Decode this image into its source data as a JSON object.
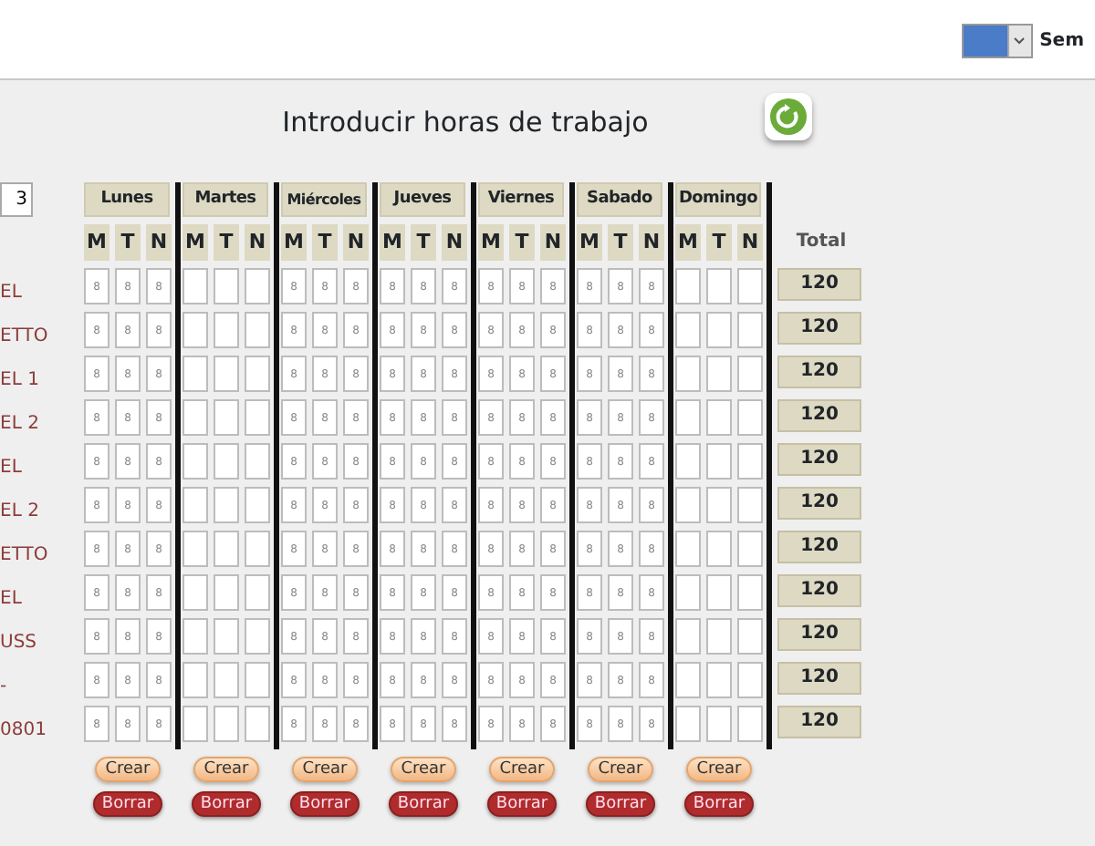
{
  "topbar": {
    "label": "Sem"
  },
  "title": "Introducir horas de trabajo",
  "week_field": {
    "value": "3"
  },
  "days": [
    {
      "label": "Lunes",
      "shifts": [
        "M",
        "T",
        "N"
      ],
      "create": "Crear",
      "delete": "Borrar"
    },
    {
      "label": "Martes",
      "shifts": [
        "M",
        "T",
        "N"
      ],
      "create": "Crear",
      "delete": "Borrar"
    },
    {
      "label": "Miércoles",
      "shifts": [
        "M",
        "T",
        "N"
      ],
      "create": "Crear",
      "delete": "Borrar"
    },
    {
      "label": "Jueves",
      "shifts": [
        "M",
        "T",
        "N"
      ],
      "create": "Crear",
      "delete": "Borrar"
    },
    {
      "label": "Viernes",
      "shifts": [
        "M",
        "T",
        "N"
      ],
      "create": "Crear",
      "delete": "Borrar"
    },
    {
      "label": "Sabado",
      "shifts": [
        "M",
        "T",
        "N"
      ],
      "create": "Crear",
      "delete": "Borrar"
    },
    {
      "label": "Domingo",
      "shifts": [
        "M",
        "T",
        "N"
      ],
      "create": "Crear",
      "delete": "Borrar"
    }
  ],
  "total_label": "Total",
  "rows": [
    {
      "name": "EL",
      "cells": [
        [
          "8",
          "8",
          "8"
        ],
        [
          "",
          "",
          ""
        ],
        [
          "8",
          "8",
          "8"
        ],
        [
          "8",
          "8",
          "8"
        ],
        [
          "8",
          "8",
          "8"
        ],
        [
          "8",
          "8",
          "8"
        ],
        [
          "",
          "",
          ""
        ]
      ],
      "total": "120"
    },
    {
      "name": "ETTO",
      "cells": [
        [
          "8",
          "8",
          "8"
        ],
        [
          "",
          "",
          ""
        ],
        [
          "8",
          "8",
          "8"
        ],
        [
          "8",
          "8",
          "8"
        ],
        [
          "8",
          "8",
          "8"
        ],
        [
          "8",
          "8",
          "8"
        ],
        [
          "",
          "",
          ""
        ]
      ],
      "total": "120"
    },
    {
      "name": "EL 1",
      "cells": [
        [
          "8",
          "8",
          "8"
        ],
        [
          "",
          "",
          ""
        ],
        [
          "8",
          "8",
          "8"
        ],
        [
          "8",
          "8",
          "8"
        ],
        [
          "8",
          "8",
          "8"
        ],
        [
          "8",
          "8",
          "8"
        ],
        [
          "",
          "",
          ""
        ]
      ],
      "total": "120"
    },
    {
      "name": "EL 2",
      "cells": [
        [
          "8",
          "8",
          "8"
        ],
        [
          "",
          "",
          ""
        ],
        [
          "8",
          "8",
          "8"
        ],
        [
          "8",
          "8",
          "8"
        ],
        [
          "8",
          "8",
          "8"
        ],
        [
          "8",
          "8",
          "8"
        ],
        [
          "",
          "",
          ""
        ]
      ],
      "total": "120"
    },
    {
      "name": "EL",
      "cells": [
        [
          "8",
          "8",
          "8"
        ],
        [
          "",
          "",
          ""
        ],
        [
          "8",
          "8",
          "8"
        ],
        [
          "8",
          "8",
          "8"
        ],
        [
          "8",
          "8",
          "8"
        ],
        [
          "8",
          "8",
          "8"
        ],
        [
          "",
          "",
          ""
        ]
      ],
      "total": "120"
    },
    {
      "name": "EL 2",
      "cells": [
        [
          "8",
          "8",
          "8"
        ],
        [
          "",
          "",
          ""
        ],
        [
          "8",
          "8",
          "8"
        ],
        [
          "8",
          "8",
          "8"
        ],
        [
          "8",
          "8",
          "8"
        ],
        [
          "8",
          "8",
          "8"
        ],
        [
          "",
          "",
          ""
        ]
      ],
      "total": "120"
    },
    {
      "name": "ETTO",
      "cells": [
        [
          "8",
          "8",
          "8"
        ],
        [
          "",
          "",
          ""
        ],
        [
          "8",
          "8",
          "8"
        ],
        [
          "8",
          "8",
          "8"
        ],
        [
          "8",
          "8",
          "8"
        ],
        [
          "8",
          "8",
          "8"
        ],
        [
          "",
          "",
          ""
        ]
      ],
      "total": "120"
    },
    {
      "name": "EL",
      "cells": [
        [
          "8",
          "8",
          "8"
        ],
        [
          "",
          "",
          ""
        ],
        [
          "8",
          "8",
          "8"
        ],
        [
          "8",
          "8",
          "8"
        ],
        [
          "8",
          "8",
          "8"
        ],
        [
          "8",
          "8",
          "8"
        ],
        [
          "",
          "",
          ""
        ]
      ],
      "total": "120"
    },
    {
      "name": "USS",
      "cells": [
        [
          "8",
          "8",
          "8"
        ],
        [
          "",
          "",
          ""
        ],
        [
          "8",
          "8",
          "8"
        ],
        [
          "8",
          "8",
          "8"
        ],
        [
          "8",
          "8",
          "8"
        ],
        [
          "8",
          "8",
          "8"
        ],
        [
          "",
          "",
          ""
        ]
      ],
      "total": "120"
    },
    {
      "name": "-",
      "cells": [
        [
          "8",
          "8",
          "8"
        ],
        [
          "",
          "",
          ""
        ],
        [
          "8",
          "8",
          "8"
        ],
        [
          "8",
          "8",
          "8"
        ],
        [
          "8",
          "8",
          "8"
        ],
        [
          "8",
          "8",
          "8"
        ],
        [
          "",
          "",
          ""
        ]
      ],
      "total": "120"
    },
    {
      "name": "0801",
      "cells": [
        [
          "8",
          "8",
          "8"
        ],
        [
          "",
          "",
          ""
        ],
        [
          "8",
          "8",
          "8"
        ],
        [
          "8",
          "8",
          "8"
        ],
        [
          "8",
          "8",
          "8"
        ],
        [
          "8",
          "8",
          "8"
        ],
        [
          "",
          "",
          ""
        ]
      ],
      "total": "120"
    }
  ]
}
